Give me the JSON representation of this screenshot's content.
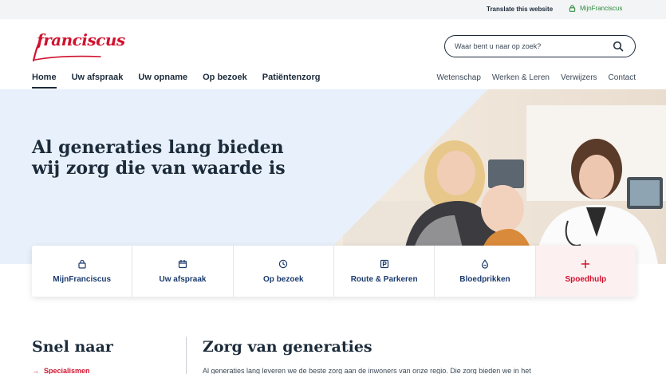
{
  "utility": {
    "translate": "Translate this website",
    "mijn": "MijnFranciscus"
  },
  "header": {
    "logo_text": "franciscus",
    "search_placeholder": "Waar bent u naar op zoek?"
  },
  "nav_main": [
    {
      "label": "Home",
      "active": true
    },
    {
      "label": "Uw afspraak"
    },
    {
      "label": "Uw opname"
    },
    {
      "label": "Op bezoek"
    },
    {
      "label": "Patiëntenzorg"
    }
  ],
  "nav_secondary": [
    "Wetenschap",
    "Werken & Leren",
    "Verwijzers",
    "Contact"
  ],
  "hero": {
    "headline": "Al generaties lang bieden wij zorg die van waarde is"
  },
  "quick_links": [
    {
      "label": "MijnFranciscus",
      "icon": "lock-icon"
    },
    {
      "label": "Uw afspraak",
      "icon": "calendar-icon"
    },
    {
      "label": "Op bezoek",
      "icon": "clock-icon"
    },
    {
      "label": "Route & Parkeren",
      "icon": "parking-icon"
    },
    {
      "label": "Bloedprikken",
      "icon": "drop-icon"
    },
    {
      "label": "Spoedhulp",
      "icon": "plus-icon"
    }
  ],
  "bottom": {
    "snel_title": "Snel naar",
    "snel_first": "Specialismen",
    "zorg_title": "Zorg van generaties",
    "zorg_text": "Al generaties lang leveren we de beste zorg aan de inwoners van onze regio. Die zorg bieden we in het"
  },
  "colors": {
    "brand_red": "#d1122e",
    "navy": "#1c2b3a",
    "hero_bg": "#e8f0fb",
    "green": "#2e8a3c"
  }
}
